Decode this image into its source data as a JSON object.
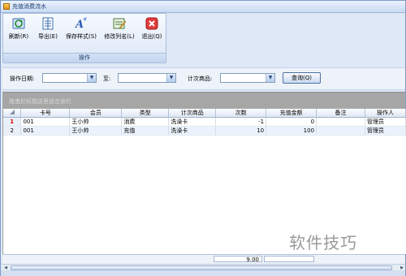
{
  "window": {
    "title": "充值消费流水"
  },
  "toolbar": {
    "buttons": [
      {
        "label": "刷新(R)",
        "icon": "refresh-icon"
      },
      {
        "label": "导出(E)",
        "icon": "export-icon"
      },
      {
        "label": "保存样式(S)",
        "icon": "save-style-icon"
      },
      {
        "label": "修改列名(L)",
        "icon": "edit-column-icon"
      },
      {
        "label": "退出(Q)",
        "icon": "exit-icon"
      }
    ],
    "group_label": "操作"
  },
  "filter": {
    "date_label": "操作日期:",
    "date_from": "",
    "to_label": "至:",
    "date_to": "",
    "item_label": "计次商品:",
    "item_value": "",
    "query_button": "查询(Q)"
  },
  "group_panel": {
    "hint": "拖曳栏标题这里组合该栏"
  },
  "table": {
    "columns": [
      "",
      "卡号",
      "会员",
      "类型",
      "计次商品",
      "次数",
      "充值金额",
      "备注",
      "操作人"
    ],
    "rows": [
      [
        "1",
        "001",
        "王小帅",
        "消费",
        "洗澡卡",
        "-1",
        "0",
        "",
        "管理员"
      ],
      [
        "2",
        "001",
        "王小帅",
        "充值",
        "洗澡卡",
        "10",
        "100",
        "",
        "管理员"
      ]
    ]
  },
  "footer": {
    "count_total": "9.00"
  },
  "watermark": "软件技巧",
  "colors": {
    "accent": "#c8daf3",
    "group_panel": "#a6a6a6",
    "selected_marker": "#dd0000"
  }
}
